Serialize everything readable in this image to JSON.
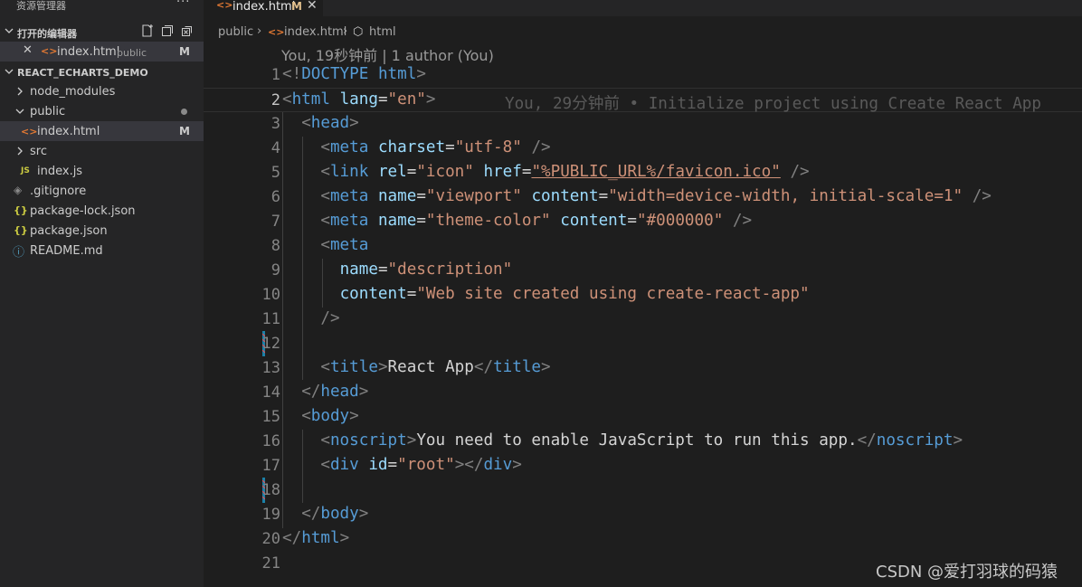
{
  "sidebar": {
    "title": "资源管理器",
    "more": "···",
    "open_editors": {
      "label": "打开的编辑器",
      "file": {
        "close": "✕",
        "icon": "<>",
        "name": "index.html",
        "dir": "public",
        "badge": "M"
      }
    },
    "project": {
      "label": "REACT_ECHARTS_DEMO",
      "items": [
        {
          "label": "node_modules",
          "kind": "folder",
          "expanded": false
        },
        {
          "label": "public",
          "kind": "folder",
          "expanded": true
        },
        {
          "label": "index.html",
          "kind": "html",
          "icon": "<>",
          "badge": "M"
        },
        {
          "label": "src",
          "kind": "folder",
          "expanded": false
        },
        {
          "label": "index.js",
          "kind": "js",
          "icon": "JS"
        },
        {
          "label": ".gitignore",
          "kind": "gitignore",
          "icon": "◈"
        },
        {
          "label": "package-lock.json",
          "kind": "json",
          "icon": "{}"
        },
        {
          "label": "package.json",
          "kind": "json",
          "icon": "{}"
        },
        {
          "label": "README.md",
          "kind": "info",
          "icon": "ⓘ"
        }
      ]
    }
  },
  "tab": {
    "icon": "<>",
    "name": "index.html",
    "badge": "M",
    "close": "✕"
  },
  "breadcrumb": {
    "part1": "public",
    "part2_icon": "<>",
    "part2": "index.html",
    "part3_icon": "⬡",
    "part3": "html"
  },
  "codelens": "You, 19秒钟前 | 1 author (You)",
  "blame": "You, 29分钟前 • Initialize project using Create React App",
  "code_lines": [
    {
      "n": "1",
      "segs": [
        [
          "p",
          "<!"
        ],
        [
          "d",
          "DOCTYPE"
        ],
        [
          "x",
          " "
        ],
        [
          "t",
          "html"
        ],
        [
          "p",
          ">"
        ]
      ]
    },
    {
      "n": "2",
      "segs": [
        [
          "p",
          "<"
        ],
        [
          "t",
          "html"
        ],
        [
          "x",
          " "
        ],
        [
          "a",
          "lang"
        ],
        [
          "x",
          "="
        ],
        [
          "s",
          "\"en\""
        ],
        [
          "p",
          ">"
        ]
      ]
    },
    {
      "n": "3",
      "segs": [
        [
          "x",
          "  "
        ],
        [
          "p",
          "<"
        ],
        [
          "t",
          "head"
        ],
        [
          "p",
          ">"
        ]
      ]
    },
    {
      "n": "4",
      "segs": [
        [
          "x",
          "    "
        ],
        [
          "p",
          "<"
        ],
        [
          "t",
          "meta"
        ],
        [
          "x",
          " "
        ],
        [
          "a",
          "charset"
        ],
        [
          "x",
          "="
        ],
        [
          "s",
          "\"utf-8\""
        ],
        [
          "x",
          " "
        ],
        [
          "p",
          "/>"
        ]
      ]
    },
    {
      "n": "5",
      "segs": [
        [
          "x",
          "    "
        ],
        [
          "p",
          "<"
        ],
        [
          "t",
          "link"
        ],
        [
          "x",
          " "
        ],
        [
          "a",
          "rel"
        ],
        [
          "x",
          "="
        ],
        [
          "s",
          "\"icon\""
        ],
        [
          "x",
          " "
        ],
        [
          "a",
          "href"
        ],
        [
          "x",
          "="
        ],
        [
          "s",
          "\"%PUBLIC_URL%/favicon.ico\""
        ],
        [
          "x",
          " "
        ],
        [
          "p",
          "/>"
        ]
      ]
    },
    {
      "n": "6",
      "segs": [
        [
          "x",
          "    "
        ],
        [
          "p",
          "<"
        ],
        [
          "t",
          "meta"
        ],
        [
          "x",
          " "
        ],
        [
          "a",
          "name"
        ],
        [
          "x",
          "="
        ],
        [
          "s",
          "\"viewport\""
        ],
        [
          "x",
          " "
        ],
        [
          "a",
          "content"
        ],
        [
          "x",
          "="
        ],
        [
          "s",
          "\"width=device-width, initial-scale=1\""
        ],
        [
          "x",
          " "
        ],
        [
          "p",
          "/>"
        ]
      ]
    },
    {
      "n": "7",
      "segs": [
        [
          "x",
          "    "
        ],
        [
          "p",
          "<"
        ],
        [
          "t",
          "meta"
        ],
        [
          "x",
          " "
        ],
        [
          "a",
          "name"
        ],
        [
          "x",
          "="
        ],
        [
          "s",
          "\"theme-color\""
        ],
        [
          "x",
          " "
        ],
        [
          "a",
          "content"
        ],
        [
          "x",
          "="
        ],
        [
          "s",
          "\"#000000\""
        ],
        [
          "x",
          " "
        ],
        [
          "p",
          "/>"
        ]
      ]
    },
    {
      "n": "8",
      "segs": [
        [
          "x",
          "    "
        ],
        [
          "p",
          "<"
        ],
        [
          "t",
          "meta"
        ]
      ]
    },
    {
      "n": "9",
      "segs": [
        [
          "x",
          "      "
        ],
        [
          "a",
          "name"
        ],
        [
          "x",
          "="
        ],
        [
          "s",
          "\"description\""
        ]
      ]
    },
    {
      "n": "10",
      "segs": [
        [
          "x",
          "      "
        ],
        [
          "a",
          "content"
        ],
        [
          "x",
          "="
        ],
        [
          "s",
          "\"Web site created using create-react-app\""
        ]
      ]
    },
    {
      "n": "11",
      "segs": [
        [
          "x",
          "    "
        ],
        [
          "p",
          "/>"
        ]
      ]
    },
    {
      "n": "12",
      "segs": []
    },
    {
      "n": "13",
      "segs": [
        [
          "x",
          "    "
        ],
        [
          "p",
          "<"
        ],
        [
          "t",
          "title"
        ],
        [
          "p",
          ">"
        ],
        [
          "x",
          "React App"
        ],
        [
          "p",
          "</"
        ],
        [
          "t",
          "title"
        ],
        [
          "p",
          ">"
        ]
      ]
    },
    {
      "n": "14",
      "segs": [
        [
          "x",
          "  "
        ],
        [
          "p",
          "</"
        ],
        [
          "t",
          "head"
        ],
        [
          "p",
          ">"
        ]
      ]
    },
    {
      "n": "15",
      "segs": [
        [
          "x",
          "  "
        ],
        [
          "p",
          "<"
        ],
        [
          "t",
          "body"
        ],
        [
          "p",
          ">"
        ]
      ]
    },
    {
      "n": "16",
      "segs": [
        [
          "x",
          "    "
        ],
        [
          "p",
          "<"
        ],
        [
          "t",
          "noscript"
        ],
        [
          "p",
          ">"
        ],
        [
          "x",
          "You need to enable JavaScript to run this app."
        ],
        [
          "p",
          "</"
        ],
        [
          "t",
          "noscript"
        ],
        [
          "p",
          ">"
        ]
      ]
    },
    {
      "n": "17",
      "segs": [
        [
          "x",
          "    "
        ],
        [
          "p",
          "<"
        ],
        [
          "t",
          "div"
        ],
        [
          "x",
          " "
        ],
        [
          "a",
          "id"
        ],
        [
          "x",
          "="
        ],
        [
          "s",
          "\"root\""
        ],
        [
          "p",
          "></"
        ],
        [
          "t",
          "div"
        ],
        [
          "p",
          ">"
        ]
      ]
    },
    {
      "n": "18",
      "segs": []
    },
    {
      "n": "19",
      "segs": [
        [
          "x",
          "  "
        ],
        [
          "p",
          "</"
        ],
        [
          "t",
          "body"
        ],
        [
          "p",
          ">"
        ]
      ]
    },
    {
      "n": "20",
      "segs": [
        [
          "p",
          "</"
        ],
        [
          "t",
          "html"
        ],
        [
          "p",
          ">"
        ]
      ]
    },
    {
      "n": "21",
      "segs": []
    }
  ],
  "watermark": "CSDN @爱打羽球的码猿",
  "colors": {
    "tag": "#569cd6",
    "attr": "#9cdcfe",
    "string": "#ce9178",
    "punct": "#808080",
    "html_icon": "#e37933",
    "js_icon": "#cbcb41",
    "json_icon": "#cbcb41",
    "modified": "#e2c08d"
  }
}
